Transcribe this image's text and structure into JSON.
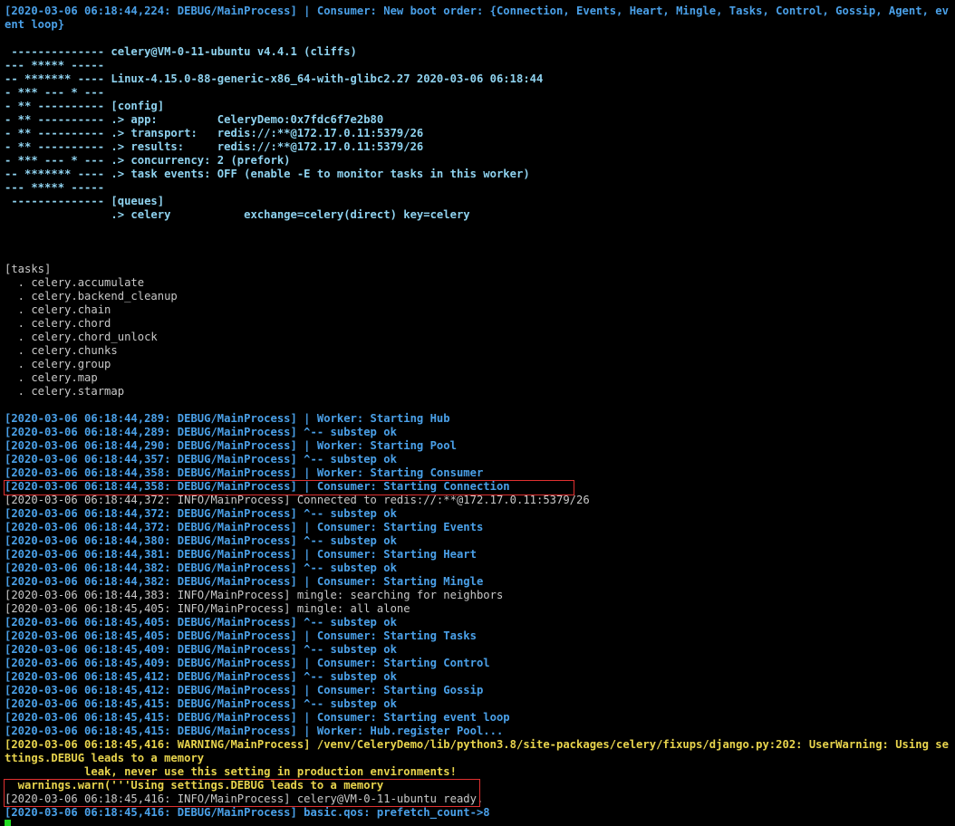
{
  "boot_line": "[2020-03-06 06:18:44,224: DEBUG/MainProcess] | Consumer: New boot order: {Connection, Events, Heart, Mingle, Tasks, Control, Gossip, Agent, event loop}",
  "banner": [
    " -------------- celery@VM-0-11-ubuntu v4.4.1 (cliffs)",
    "--- ***** -----",
    "-- ******* ---- Linux-4.15.0-88-generic-x86_64-with-glibc2.27 2020-03-06 06:18:44",
    "- *** --- * ---",
    "- ** ---------- [config]",
    "- ** ---------- .> app:         CeleryDemo:0x7fdc6f7e2b80",
    "- ** ---------- .> transport:   redis://:**@172.17.0.11:5379/26",
    "- ** ---------- .> results:     redis://:**@172.17.0.11:5379/26",
    "- *** --- * --- .> concurrency: 2 (prefork)",
    "-- ******* ---- .> task events: OFF (enable -E to monitor tasks in this worker)",
    "--- ***** -----",
    " -------------- [queues]",
    "                .> celery           exchange=celery(direct) key=celery"
  ],
  "tasks_header": "[tasks]",
  "tasks": [
    "  . celery.accumulate",
    "  . celery.backend_cleanup",
    "  . celery.chain",
    "  . celery.chord",
    "  . celery.chord_unlock",
    "  . celery.chunks",
    "  . celery.group",
    "  . celery.map",
    "  . celery.starmap"
  ],
  "log": [
    {
      "text": "[2020-03-06 06:18:44,289: DEBUG/MainProcess] | Worker: Starting Hub",
      "level": "debug"
    },
    {
      "text": "[2020-03-06 06:18:44,289: DEBUG/MainProcess] ^-- substep ok",
      "level": "debug"
    },
    {
      "text": "[2020-03-06 06:18:44,290: DEBUG/MainProcess] | Worker: Starting Pool",
      "level": "debug"
    },
    {
      "text": "[2020-03-06 06:18:44,357: DEBUG/MainProcess] ^-- substep ok",
      "level": "debug"
    },
    {
      "text": "[2020-03-06 06:18:44,358: DEBUG/MainProcess] | Worker: Starting Consumer",
      "level": "debug"
    },
    {
      "text": "[2020-03-06 06:18:44,358: DEBUG/MainProcess] | Consumer: Starting Connection",
      "level": "debug"
    },
    {
      "text": "[2020-03-06 06:18:44,372: INFO/MainProcess] Connected to redis://:**@172.17.0.11:5379/26",
      "level": "info"
    },
    {
      "text": "[2020-03-06 06:18:44,372: DEBUG/MainProcess] ^-- substep ok",
      "level": "debug"
    },
    {
      "text": "[2020-03-06 06:18:44,372: DEBUG/MainProcess] | Consumer: Starting Events",
      "level": "debug"
    },
    {
      "text": "[2020-03-06 06:18:44,380: DEBUG/MainProcess] ^-- substep ok",
      "level": "debug"
    },
    {
      "text": "[2020-03-06 06:18:44,381: DEBUG/MainProcess] | Consumer: Starting Heart",
      "level": "debug"
    },
    {
      "text": "[2020-03-06 06:18:44,382: DEBUG/MainProcess] ^-- substep ok",
      "level": "debug"
    },
    {
      "text": "[2020-03-06 06:18:44,382: DEBUG/MainProcess] | Consumer: Starting Mingle",
      "level": "debug"
    },
    {
      "text": "[2020-03-06 06:18:44,383: INFO/MainProcess] mingle: searching for neighbors",
      "level": "info"
    },
    {
      "text": "[2020-03-06 06:18:45,405: INFO/MainProcess] mingle: all alone",
      "level": "info"
    },
    {
      "text": "[2020-03-06 06:18:45,405: DEBUG/MainProcess] ^-- substep ok",
      "level": "debug"
    },
    {
      "text": "[2020-03-06 06:18:45,405: DEBUG/MainProcess] | Consumer: Starting Tasks",
      "level": "debug"
    },
    {
      "text": "[2020-03-06 06:18:45,409: DEBUG/MainProcess] ^-- substep ok",
      "level": "debug"
    },
    {
      "text": "[2020-03-06 06:18:45,409: DEBUG/MainProcess] | Consumer: Starting Control",
      "level": "debug"
    },
    {
      "text": "[2020-03-06 06:18:45,412: DEBUG/MainProcess] ^-- substep ok",
      "level": "debug"
    },
    {
      "text": "[2020-03-06 06:18:45,412: DEBUG/MainProcess] | Consumer: Starting Gossip",
      "level": "debug"
    },
    {
      "text": "[2020-03-06 06:18:45,415: DEBUG/MainProcess] ^-- substep ok",
      "level": "debug"
    },
    {
      "text": "[2020-03-06 06:18:45,415: DEBUG/MainProcess] | Consumer: Starting event loop",
      "level": "debug"
    },
    {
      "text": "[2020-03-06 06:18:45,415: DEBUG/MainProcess] | Worker: Hub.register Pool...",
      "level": "debug"
    }
  ],
  "warning": [
    "[2020-03-06 06:18:45,416: WARNING/MainProcess] /venv/CeleryDemo/lib/python3.8/site-packages/celery/fixups/django.py:202: UserWarning: Using settings.DEBUG leads to a memory",
    "            leak, never use this setting in production environments!",
    "  warnings.warn('''Using settings.DEBUG leads to a memory"
  ],
  "final": [
    {
      "text": "[2020-03-06 06:18:45,416: INFO/MainProcess] celery@VM-0-11-ubuntu ready.",
      "level": "info"
    },
    {
      "text": "[2020-03-06 06:18:45,416: DEBUG/MainProcess] basic.qos: prefetch_count->8",
      "level": "debug"
    }
  ],
  "colors": {
    "background": "#000000",
    "debug": "#4aa0e8",
    "banner": "#8fd3f0",
    "info": "#c8c8c8",
    "warning": "#e8d44d",
    "highlight_box": "#e03030",
    "cursor": "#22dd22"
  }
}
